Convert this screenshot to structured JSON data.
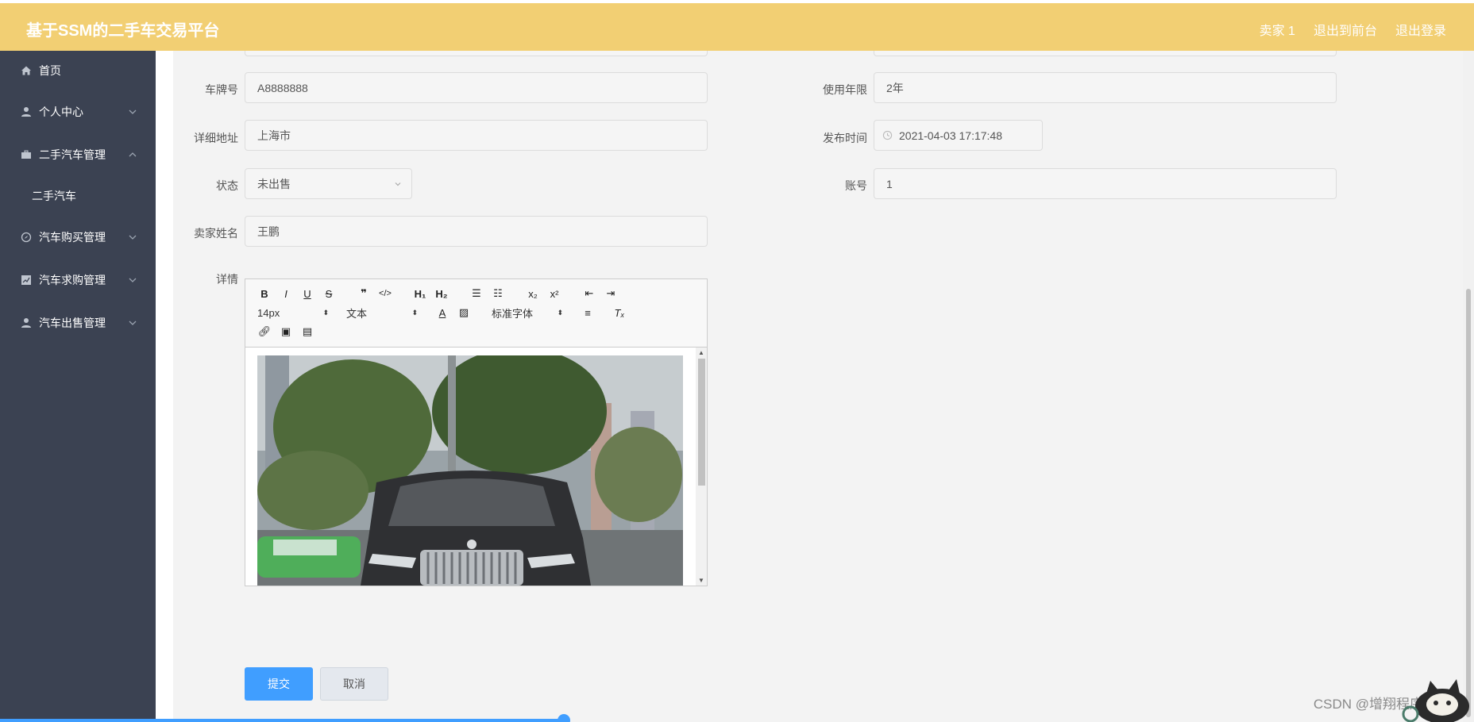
{
  "header": {
    "title": "基于SSM的二手车交易平台",
    "links": [
      "卖家 1",
      "退出到前台",
      "退出登录"
    ]
  },
  "sidebar": {
    "items": [
      {
        "label": "首页",
        "icon": "home-icon"
      },
      {
        "label": "个人中心",
        "icon": "user-icon"
      },
      {
        "label": "二手汽车管理",
        "icon": "suitcase-icon"
      },
      {
        "label": "汽车购买管理",
        "icon": "compass-icon"
      },
      {
        "label": "汽车求购管理",
        "icon": "chart-icon"
      },
      {
        "label": "汽车出售管理",
        "icon": "user-icon"
      }
    ],
    "sub_item": "二手汽车"
  },
  "form": {
    "plate_label": "车牌号",
    "plate_value": "A8888888",
    "years_label": "使用年限",
    "years_value": "2年",
    "address_label": "详细地址",
    "address_value": "上海市",
    "publish_label": "发布时间",
    "publish_value": "2021-04-03 17:17:48",
    "status_label": "状态",
    "status_value": "未出售",
    "account_label": "账号",
    "account_value": "1",
    "seller_label": "卖家姓名",
    "seller_value": "王鹏",
    "detail_label": "详情"
  },
  "editor": {
    "font_size": "14px",
    "text_type": "文本",
    "font_family": "标准字体"
  },
  "actions": {
    "submit": "提交",
    "cancel": "取消"
  },
  "watermark": "CSDN @增翔程序设计",
  "colors": {
    "header": "#f2cf73",
    "sidebar": "#3b4252",
    "primary": "#409eff"
  }
}
